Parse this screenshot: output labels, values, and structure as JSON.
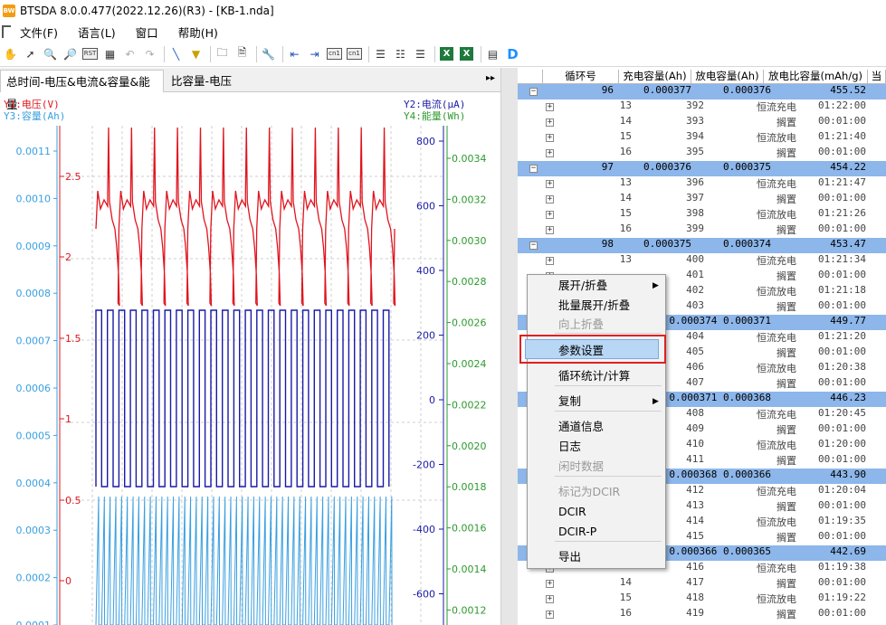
{
  "window": {
    "title": "BTSDA 8.0.0.477(2022.12.26)(R3) - [KB-1.nda]",
    "icon": "BW"
  },
  "menu": {
    "items": [
      "文件(F)",
      "语言(L)",
      "窗口",
      "帮助(H)"
    ]
  },
  "toolbar": {
    "icons": [
      "hand-icon",
      "pointer-icon",
      "zoom-in-icon",
      "zoom-out-icon",
      "rst-icon",
      "table-icon",
      "undo-icon",
      "redo-icon",
      "pen-icon",
      "filter-icon",
      "open-folder-icon",
      "save-icon",
      "tool-icon",
      "arrow-left-icon",
      "arrow-right-icon",
      "cycle1-icon",
      "cycle2-icon",
      "grid1-icon",
      "grid2-icon",
      "grid3-icon",
      "excel1-icon",
      "excel2-icon",
      "report-icon",
      "d-icon"
    ],
    "rst_label": "RST",
    "cycle_label": "cn1",
    "cycle_label2": "cn1",
    "excel_label": "X",
    "d_label": "D"
  },
  "tabs": [
    {
      "label": "总时间-电压&电流&容量&能量"
    },
    {
      "label": "比容量-电压"
    }
  ],
  "tab_arrow": "▸▸",
  "chart": {
    "y1_label": "Y1:电压(V)",
    "y3_label": "Y3:容量(Ah)",
    "y2_label": "Y2:电流(μA)",
    "y4_label": "Y4:能量(Wh)",
    "y3_ticks": [
      "0.0011",
      "0.0010",
      "0.0009",
      "0.0008",
      "0.0007",
      "0.0006",
      "0.0005",
      "0.0004",
      "0.0003",
      "0.0002",
      "0.0001"
    ],
    "y1_ticks": [
      "2.5",
      "2",
      "1.5",
      "1",
      "0.5",
      "0"
    ],
    "y2_ticks": [
      "800",
      "600",
      "400",
      "200",
      "0",
      "-200",
      "-400",
      "-600"
    ],
    "y4_ticks": [
      "0.0034",
      "0.0032",
      "0.0030",
      "0.0028",
      "0.0026",
      "0.0024",
      "0.0022",
      "0.0020",
      "0.0018",
      "0.0016",
      "0.0014",
      "0.0012"
    ],
    "colors": {
      "voltage": "#e0141e",
      "current": "#1a1aa6",
      "capacity": "#3a9fe0",
      "energy": "#2e9a2e",
      "y1_axis": "#e0141e",
      "y3_axis": "#3a9fe0",
      "y2_axis": "#1a1aa6",
      "y4_axis": "#2e9a2e"
    }
  },
  "table": {
    "headers": [
      "",
      "循环号",
      "充电容量(Ah)",
      "放电容量(Ah)",
      "放电比容量(mAh/g)",
      "当"
    ],
    "rows": [
      {
        "type": "cycle",
        "sign": "−",
        "a": "96",
        "b": "0.000377",
        "c": "0.000376",
        "d": "455.52"
      },
      {
        "type": "step",
        "sign": "+",
        "a": "13",
        "b": "392",
        "c": "恒流充电",
        "d": "01:22:00"
      },
      {
        "type": "step",
        "sign": "+",
        "a": "14",
        "b": "393",
        "c": "搁置",
        "d": "00:01:00"
      },
      {
        "type": "step",
        "sign": "+",
        "a": "15",
        "b": "394",
        "c": "恒流放电",
        "d": "01:21:40"
      },
      {
        "type": "step",
        "sign": "+",
        "a": "16",
        "b": "395",
        "c": "搁置",
        "d": "00:01:00"
      },
      {
        "type": "cycle",
        "sign": "−",
        "a": "97",
        "b": "0.000376",
        "c": "0.000375",
        "d": "454.22"
      },
      {
        "type": "step",
        "sign": "+",
        "a": "13",
        "b": "396",
        "c": "恒流充电",
        "d": "01:21:47"
      },
      {
        "type": "step",
        "sign": "+",
        "a": "14",
        "b": "397",
        "c": "搁置",
        "d": "00:01:00"
      },
      {
        "type": "step",
        "sign": "+",
        "a": "15",
        "b": "398",
        "c": "恒流放电",
        "d": "01:21:26"
      },
      {
        "type": "step",
        "sign": "+",
        "a": "16",
        "b": "399",
        "c": "搁置",
        "d": "00:01:00"
      },
      {
        "type": "cycle",
        "sign": "−",
        "a": "98",
        "b": "0.000375",
        "c": "0.000374",
        "d": "453.47"
      },
      {
        "type": "step",
        "sign": "+",
        "a": "13",
        "b": "400",
        "c": "恒流充电",
        "d": "01:21:34"
      },
      {
        "type": "step",
        "sign": "+",
        "a": "",
        "b": "401",
        "c": "搁置",
        "d": "00:01:00"
      },
      {
        "type": "step",
        "sign": "+",
        "a": "",
        "b": "402",
        "c": "恒流放电",
        "d": "01:21:18"
      },
      {
        "type": "step",
        "sign": "+",
        "a": "",
        "b": "403",
        "c": "搁置",
        "d": "00:01:00"
      },
      {
        "type": "cycle",
        "sign": "−",
        "a": "",
        "b": "",
        "c": "0.000374 0.000371",
        "d": "449.77"
      },
      {
        "type": "step",
        "sign": "+",
        "a": "",
        "b": "404",
        "c": "恒流充电",
        "d": "01:21:20"
      },
      {
        "type": "step",
        "sign": "+",
        "a": "",
        "b": "405",
        "c": "搁置",
        "d": "00:01:00"
      },
      {
        "type": "step",
        "sign": "+",
        "a": "",
        "b": "406",
        "c": "恒流放电",
        "d": "01:20:38"
      },
      {
        "type": "step",
        "sign": "+",
        "a": "",
        "b": "407",
        "c": "搁置",
        "d": "00:01:00"
      },
      {
        "type": "cycle",
        "sign": "−",
        "a": "",
        "b": "",
        "c": "0.000371 0.000368",
        "d": "446.23"
      },
      {
        "type": "step",
        "sign": "+",
        "a": "",
        "b": "408",
        "c": "恒流充电",
        "d": "01:20:45"
      },
      {
        "type": "step",
        "sign": "+",
        "a": "",
        "b": "409",
        "c": "搁置",
        "d": "00:01:00"
      },
      {
        "type": "step",
        "sign": "+",
        "a": "",
        "b": "410",
        "c": "恒流放电",
        "d": "01:20:00"
      },
      {
        "type": "step",
        "sign": "+",
        "a": "",
        "b": "411",
        "c": "搁置",
        "d": "00:01:00"
      },
      {
        "type": "cycle",
        "sign": "−",
        "a": "",
        "b": "",
        "c": "0.000368 0.000366",
        "d": "443.90"
      },
      {
        "type": "step",
        "sign": "+",
        "a": "",
        "b": "412",
        "c": "恒流充电",
        "d": "01:20:04"
      },
      {
        "type": "step",
        "sign": "+",
        "a": "",
        "b": "413",
        "c": "搁置",
        "d": "00:01:00"
      },
      {
        "type": "step",
        "sign": "+",
        "a": "",
        "b": "414",
        "c": "恒流放电",
        "d": "01:19:35"
      },
      {
        "type": "step",
        "sign": "+",
        "a": "",
        "b": "415",
        "c": "搁置",
        "d": "00:01:00"
      },
      {
        "type": "cycle",
        "sign": "−",
        "a": "",
        "b": "",
        "c": "0.000366 0.000365",
        "d": "442.69"
      },
      {
        "type": "step",
        "sign": "+",
        "a": "",
        "b": "416",
        "c": "恒流充电",
        "d": "01:19:38"
      },
      {
        "type": "step",
        "sign": "+",
        "a": "14",
        "b": "417",
        "c": "搁置",
        "d": "00:01:00"
      },
      {
        "type": "step",
        "sign": "+",
        "a": "15",
        "b": "418",
        "c": "恒流放电",
        "d": "01:19:22"
      },
      {
        "type": "step",
        "sign": "+",
        "a": "16",
        "b": "419",
        "c": "搁置",
        "d": "00:01:00"
      }
    ]
  },
  "context_menu": {
    "items": [
      {
        "label": "展开/折叠",
        "submenu": true,
        "disabled": false
      },
      {
        "label": "批量展开/折叠",
        "disabled": false
      },
      {
        "label": "向上折叠",
        "disabled": true
      },
      {
        "label": "参数设置",
        "disabled": false,
        "highlighted": true
      },
      {
        "label": "循环统计/计算",
        "disabled": false
      },
      {
        "label": "复制",
        "submenu": true,
        "disabled": false
      },
      {
        "label": "通道信息",
        "disabled": false
      },
      {
        "label": "日志",
        "disabled": false
      },
      {
        "label": "闲时数据",
        "disabled": true
      },
      {
        "label": "标记为DCIR",
        "disabled": true
      },
      {
        "label": "DCIR",
        "disabled": false
      },
      {
        "label": "DCIR-P",
        "disabled": false
      },
      {
        "label": "导出",
        "disabled": false
      }
    ]
  }
}
